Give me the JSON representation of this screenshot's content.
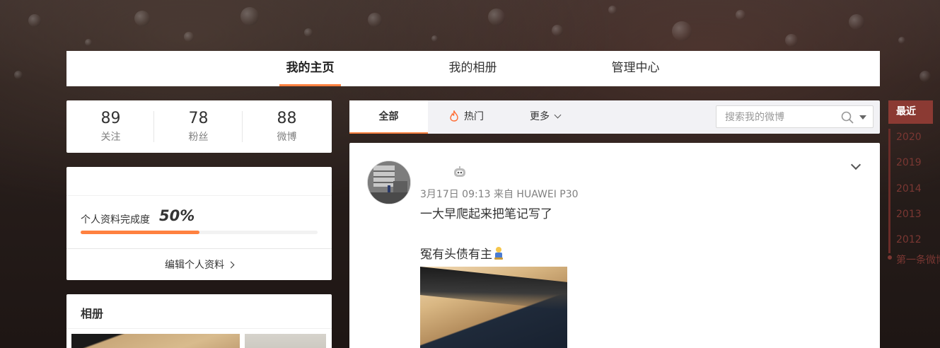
{
  "top_nav": {
    "tabs": [
      {
        "label": "我的主页",
        "active": true
      },
      {
        "label": "我的相册",
        "active": false
      },
      {
        "label": "管理中心",
        "active": false
      }
    ]
  },
  "counts": [
    {
      "value": "89",
      "label": "关注"
    },
    {
      "value": "78",
      "label": "粉丝"
    },
    {
      "value": "88",
      "label": "微博"
    }
  ],
  "profile": {
    "completeness_label": "个人资料完成度",
    "completeness_value": "50%",
    "completeness_fraction": 0.5,
    "edit_label": "编辑个人资料"
  },
  "album": {
    "title": "相册"
  },
  "feed_tabs": {
    "all": "全部",
    "hot": "热门",
    "more": "更多",
    "search_placeholder": "搜索我的微博"
  },
  "post": {
    "meta": "3月17日 09:13 来自 HUAWEI P30",
    "line1": "一大早爬起来把笔记写了",
    "line2": "冤有头债有主"
  },
  "timeline": {
    "current": "最近",
    "years": [
      "2020",
      "2019",
      "2014",
      "2013",
      "2012"
    ],
    "first": "第一条微博"
  },
  "colors": {
    "accent": "#ff8140",
    "timeline_active": "#8b3a33",
    "timeline_text": "#7a3732"
  }
}
